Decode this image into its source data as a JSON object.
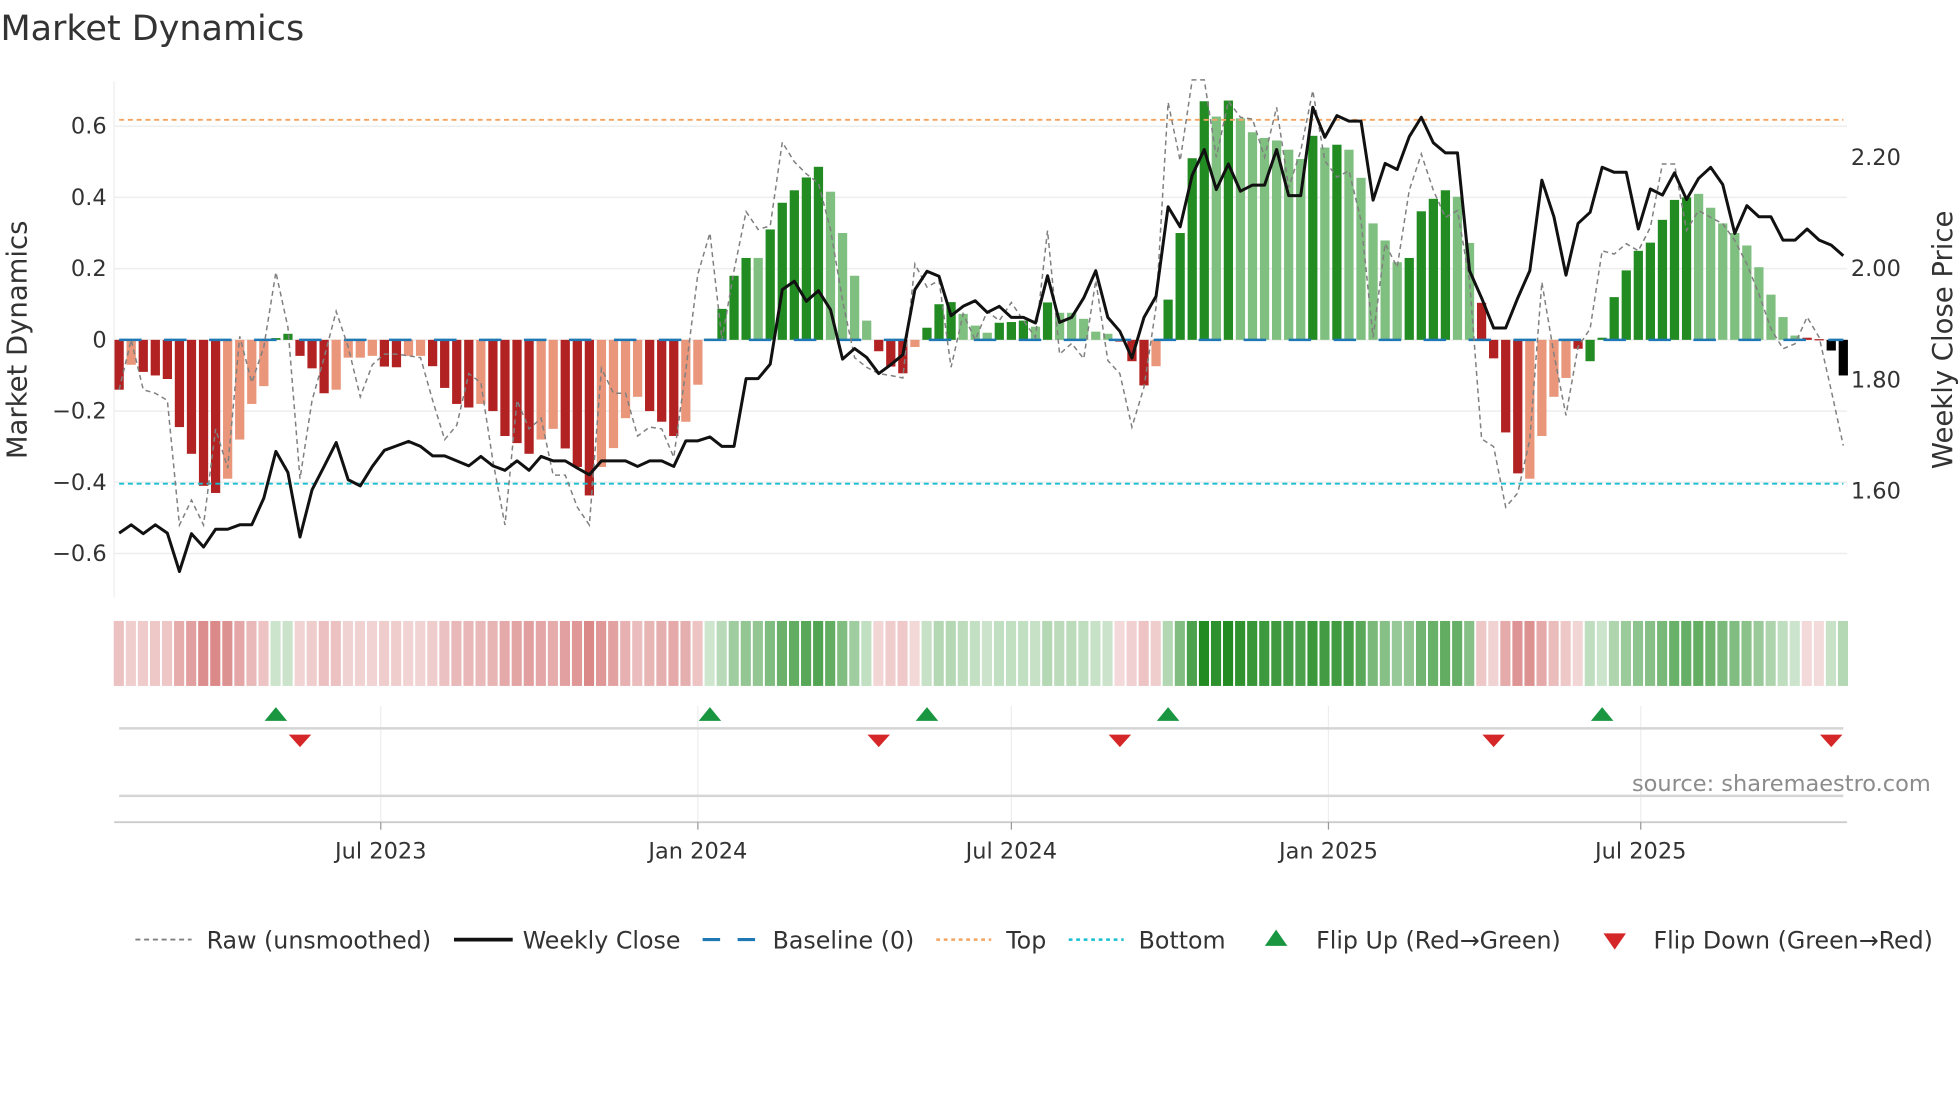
{
  "title": "Market Dynamics",
  "source_note": "source: sharemaestro.com",
  "colors": {
    "dark_red": "#b22222",
    "light_red": "#e9967a",
    "dark_green": "#228b22",
    "light_green": "#7fbf7f",
    "strip_red": "#cd5c5c",
    "strip_green": "#228b22",
    "raw": "#808080",
    "close": "#111111",
    "baseline": "#1f77b4",
    "top": "#f4a460",
    "bottom": "#17becf",
    "flip_up": "#1a9641",
    "flip_down": "#d62728"
  },
  "chart_data": {
    "type": "bar",
    "title": "Market Dynamics",
    "ylabel": "Market Dynamics",
    "y2label": "Weekly Close Price",
    "ylim": [
      -0.723,
      0.726
    ],
    "y2lim": [
      1.407,
      2.335
    ],
    "yticks": [
      {
        "v": 0.6,
        "label": "0.6"
      },
      {
        "v": 0.4,
        "label": "0.4"
      },
      {
        "v": 0.2,
        "label": "0.2"
      },
      {
        "v": 0,
        "label": "0"
      },
      {
        "v": -0.2,
        "label": "−0.2"
      },
      {
        "v": -0.4,
        "label": "−0.4"
      },
      {
        "v": -0.6,
        "label": "−0.6"
      }
    ],
    "y2ticks": [
      {
        "v": 2.2,
        "label": "2.20"
      },
      {
        "v": 2.0,
        "label": "2.00"
      },
      {
        "v": 1.8,
        "label": "1.80"
      },
      {
        "v": 1.6,
        "label": "1.60"
      }
    ],
    "xticks": [
      {
        "week": 21.7,
        "label": "Jul 2023"
      },
      {
        "week": 48.0,
        "label": "Jan 2024"
      },
      {
        "week": 74.0,
        "label": "Jul 2024"
      },
      {
        "week": 100.3,
        "label": "Jan 2025"
      },
      {
        "week": 126.2,
        "label": "Jul 2025"
      }
    ],
    "grid": true,
    "top_level": 0.618,
    "bottom_level": -0.404,
    "baseline": 0,
    "legend_position": "bottom",
    "legend": [
      "Raw (unsmoothed)",
      "Weekly Close",
      "Baseline (0)",
      "Top",
      "Bottom",
      "Flip Up (Red→Green)",
      "Flip Down (Green→Red)"
    ],
    "momentum": [
      -0.14,
      -0.07,
      -0.09,
      -0.1,
      -0.11,
      -0.245,
      -0.32,
      -0.41,
      -0.43,
      -0.39,
      -0.28,
      -0.18,
      -0.13,
      0.005,
      0.017,
      -0.045,
      -0.08,
      -0.15,
      -0.14,
      -0.05,
      -0.05,
      -0.045,
      -0.075,
      -0.077,
      -0.045,
      -0.045,
      -0.074,
      -0.135,
      -0.18,
      -0.19,
      -0.18,
      -0.2,
      -0.27,
      -0.29,
      -0.32,
      -0.28,
      -0.25,
      -0.305,
      -0.357,
      -0.437,
      -0.357,
      -0.304,
      -0.22,
      -0.16,
      -0.2,
      -0.23,
      -0.27,
      -0.23,
      -0.126,
      0.003,
      0.087,
      0.18,
      0.23,
      0.23,
      0.31,
      0.385,
      0.42,
      0.456,
      0.486,
      0.416,
      0.3,
      0.18,
      0.054,
      -0.032,
      -0.075,
      -0.094,
      -0.02,
      0.034,
      0.1,
      0.106,
      0.073,
      0.04,
      0.02,
      0.048,
      0.05,
      0.054,
      0.037,
      0.105,
      0.076,
      0.076,
      0.059,
      0.023,
      0.017,
      -0.005,
      -0.06,
      -0.128,
      -0.074,
      0.113,
      0.3,
      0.51,
      0.67,
      0.627,
      0.672,
      0.622,
      0.583,
      0.567,
      0.56,
      0.534,
      0.508,
      0.573,
      0.54,
      0.548,
      0.534,
      0.455,
      0.327,
      0.279,
      0.218,
      0.23,
      0.361,
      0.396,
      0.42,
      0.402,
      0.272,
      0.104,
      -0.052,
      -0.26,
      -0.375,
      -0.39,
      -0.27,
      -0.16,
      -0.107,
      -0.025,
      -0.06,
      0.006,
      0.12,
      0.195,
      0.25,
      0.273,
      0.337,
      0.393,
      0.4,
      0.41,
      0.371,
      0.327,
      0.3,
      0.265,
      0.204,
      0.127,
      0.064,
      0.012,
      0.006,
      0.002,
      -0.03,
      -0.1
    ],
    "states": "RrRRRRRRRrrrrGGRRRrrrrRRrrRRRRrRRRRrrRRRrrrrRRRrrGGGGgGGGGGggggRRRrGGGgggGGGgGgggggRRRrGGGGgGggggggGgGgggggGGGGggRRRRrrrrRGGGGGGGGGgggggggggRR",
    "raw": [
      -0.14,
      0,
      -0.14,
      -0.15,
      -0.17,
      -0.52,
      -0.45,
      -0.52,
      -0.25,
      -0.36,
      0.01,
      -0.12,
      -0.02,
      0.19,
      0.035,
      -0.39,
      -0.17,
      -0.05,
      0.08,
      -0.02,
      -0.16,
      -0.07,
      -0.04,
      -0.04,
      -0.045,
      -0.05,
      -0.17,
      -0.28,
      -0.24,
      -0.095,
      -0.12,
      -0.34,
      -0.52,
      -0.17,
      -0.25,
      -0.22,
      -0.38,
      -0.38,
      -0.47,
      -0.52,
      -0.08,
      -0.15,
      -0.15,
      -0.27,
      -0.245,
      -0.25,
      -0.33,
      -0.085,
      0.185,
      0.3,
      0,
      0.195,
      0.36,
      0.31,
      0.32,
      0.555,
      0.5,
      0.466,
      0.44,
      0.31,
      0.11,
      -0.05,
      -0.077,
      -0.095,
      -0.1,
      -0.107,
      0.213,
      0.148,
      0.167,
      -0.077,
      0.073,
      0,
      0.08,
      0.054,
      0.105,
      0.054,
      0.007,
      0.307,
      -0.04,
      -0.01,
      -0.053,
      0.167,
      -0.058,
      -0.095,
      -0.245,
      -0.133,
      0.092,
      0.667,
      0.503,
      0.73,
      0.73,
      0.513,
      0.67,
      0.625,
      0.62,
      0.513,
      0.653,
      0.428,
      0.531,
      0.7,
      0.503,
      0.457,
      0.475,
      0.335,
      0.007,
      0.27,
      0.204,
      0.42,
      0.522,
      0.42,
      0.344,
      0.363,
      0.167,
      -0.278,
      -0.3,
      -0.47,
      -0.43,
      -0.28,
      0.162,
      -0.04,
      -0.212,
      -0.02,
      0.031,
      0.25,
      0.241,
      0.27,
      0.25,
      0.316,
      0.494,
      0.494,
      0.307,
      0.363,
      0.344,
      0.326,
      0.279,
      0.213,
      0.129,
      0.031,
      -0.025,
      -0.011,
      0.064,
      0.007,
      -0.142,
      -0.297
    ],
    "close": [
      1.522,
      1.537,
      1.521,
      1.537,
      1.522,
      1.453,
      1.521,
      1.497,
      1.529,
      1.529,
      1.537,
      1.537,
      1.585,
      1.669,
      1.631,
      1.515,
      1.6,
      1.642,
      1.685,
      1.618,
      1.607,
      1.642,
      1.671,
      1.679,
      1.687,
      1.678,
      1.661,
      1.661,
      1.652,
      1.643,
      1.66,
      1.643,
      1.635,
      1.652,
      1.635,
      1.66,
      1.652,
      1.652,
      1.639,
      1.627,
      1.652,
      1.652,
      1.652,
      1.642,
      1.652,
      1.652,
      1.642,
      1.688,
      1.688,
      1.695,
      1.678,
      1.678,
      1.8,
      1.8,
      1.826,
      1.96,
      1.975,
      1.939,
      1.958,
      1.924,
      1.835,
      1.854,
      1.838,
      1.809,
      1.825,
      1.843,
      1.96,
      1.993,
      1.984,
      1.913,
      1.93,
      1.94,
      1.919,
      1.93,
      1.91,
      1.91,
      1.9,
      1.985,
      1.901,
      1.91,
      1.945,
      1.994,
      1.91,
      1.885,
      1.837,
      1.91,
      1.948,
      2.109,
      2.073,
      2.166,
      2.212,
      2.14,
      2.186,
      2.137,
      2.148,
      2.148,
      2.212,
      2.129,
      2.129,
      2.288,
      2.234,
      2.273,
      2.263,
      2.263,
      2.121,
      2.187,
      2.176,
      2.235,
      2.27,
      2.224,
      2.206,
      2.206,
      1.994,
      1.945,
      1.891,
      1.891,
      1.945,
      1.994,
      2.157,
      2.091,
      1.986,
      2.079,
      2.099,
      2.18,
      2.171,
      2.171,
      2.069,
      2.141,
      2.13,
      2.17,
      2.122,
      2.16,
      2.18,
      2.149,
      2.061,
      2.111,
      2.091,
      2.091,
      2.049,
      2.049,
      2.069,
      2.049,
      2.04,
      2.021
    ],
    "flip_up_weeks": [
      13,
      49,
      67,
      87,
      123
    ],
    "flip_down_weeks": [
      15,
      63,
      83,
      114,
      142
    ]
  }
}
